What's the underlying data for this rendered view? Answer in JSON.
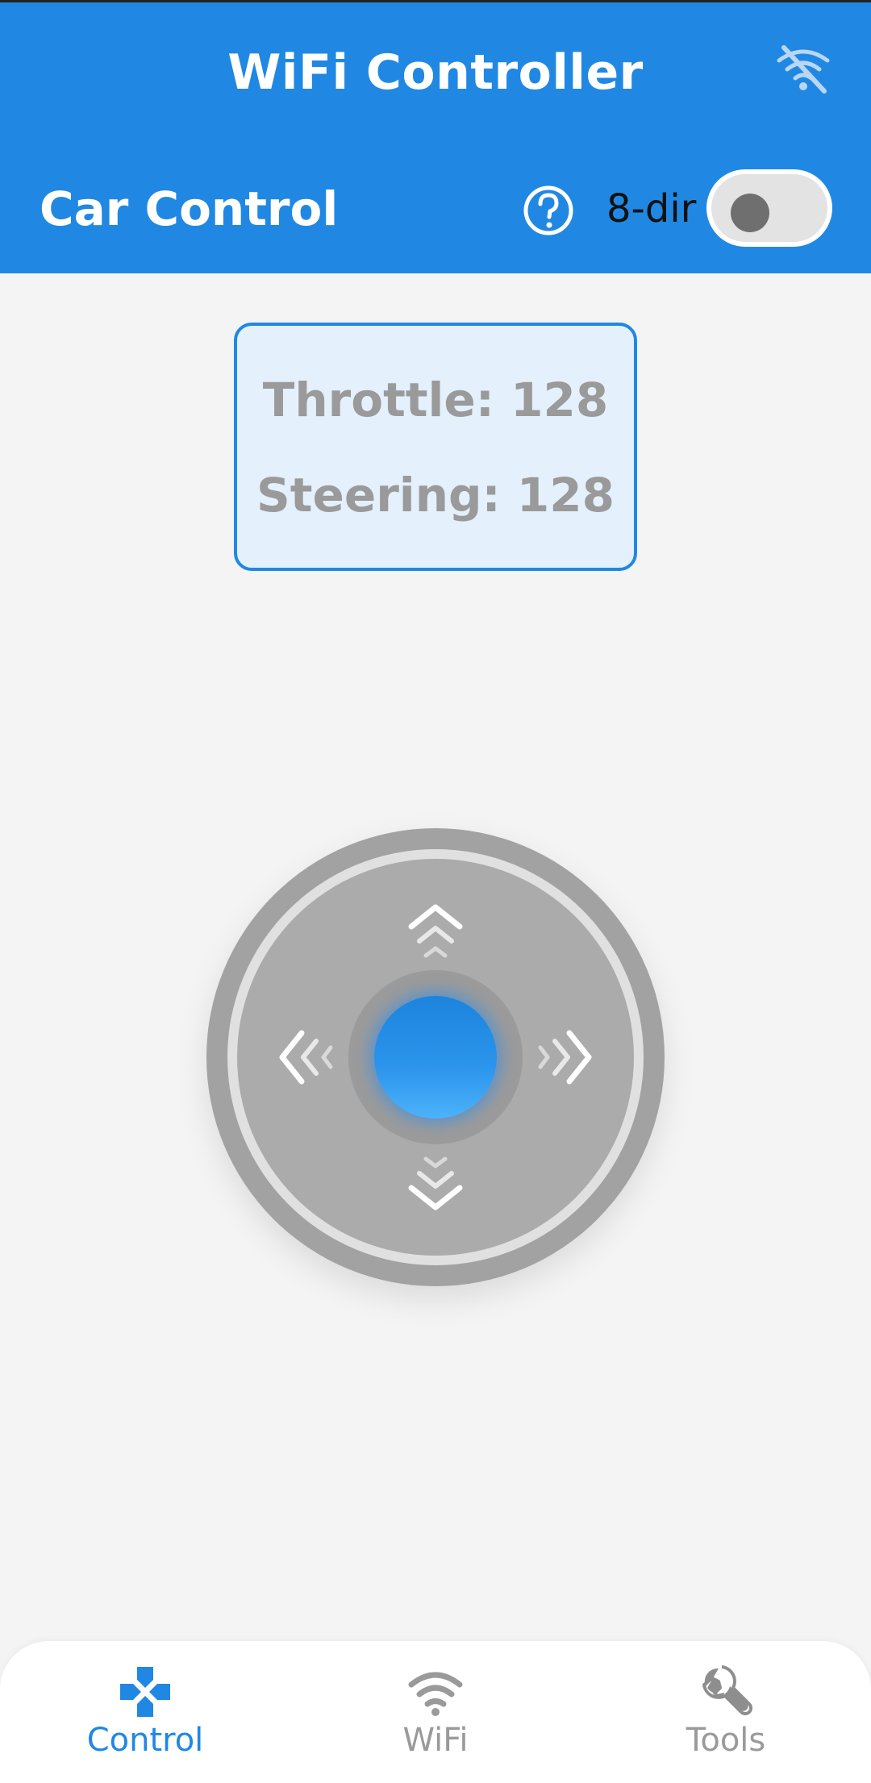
{
  "header": {
    "app_title": "WiFi Controller",
    "wifi_status_icon": "wifi-off-icon",
    "section_title": "Car Control",
    "help_icon": "help-circle-icon",
    "mode_label": "8-dir",
    "mode_toggle_on": false
  },
  "readout": {
    "throttle": "Throttle: 128",
    "steering": "Steering: 128"
  },
  "joystick": {
    "up_icon": "chevrons-up-icon",
    "down_icon": "chevrons-down-icon",
    "left_icon": "chevrons-left-icon",
    "right_icon": "chevrons-right-icon"
  },
  "nav": {
    "items": [
      {
        "label": "Control",
        "icon": "gamepad-icon",
        "active": true
      },
      {
        "label": "WiFi",
        "icon": "wifi-icon",
        "active": false
      },
      {
        "label": "Tools",
        "icon": "wrench-icon",
        "active": false
      }
    ]
  },
  "colors": {
    "primary": "#2088e3",
    "background": "#f4f4f4",
    "readout_bg": "#e4f0fc",
    "muted_text": "#9a9a9a"
  }
}
